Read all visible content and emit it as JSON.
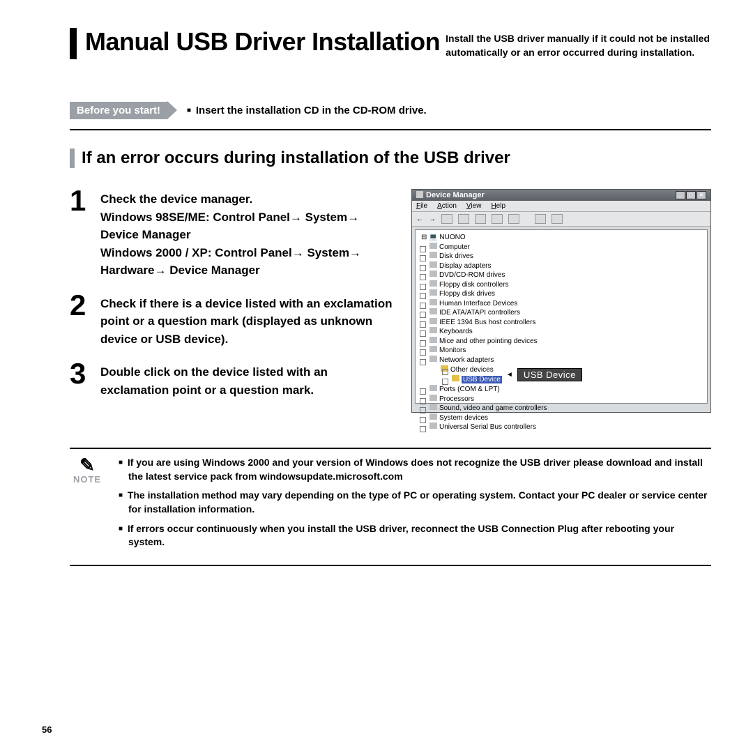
{
  "header": {
    "title": "Manual USB Driver Installation",
    "subtitle": "Install the USB driver manually if it could not be installed automatically or an error occurred during installation."
  },
  "before": {
    "badge": "Before you start!",
    "text": "Insert the installation CD in the CD-ROM drive."
  },
  "section_heading": "If an error occurs during installation of the USB driver",
  "steps": [
    {
      "n": "1",
      "text": "Check the device manager.\nWindows 98SE/ME: Control Panel→ System→ Device Manager\nWindows 2000 / XP: Control Panel→ System→ Hardware→ Device Manager"
    },
    {
      "n": "2",
      "text": "Check if there is a device listed with an exclamation point or a question mark (displayed as unknown device or USB device)."
    },
    {
      "n": "3",
      "text": "Double click on the device listed with an exclamation point or a question mark."
    }
  ],
  "devmgr": {
    "title": "Device Manager",
    "menu": [
      "File",
      "Action",
      "View",
      "Help"
    ],
    "root": "NUONO",
    "items": [
      "Computer",
      "Disk drives",
      "Display adapters",
      "DVD/CD-ROM drives",
      "Floppy disk controllers",
      "Floppy disk drives",
      "Human Interface Devices",
      "IDE ATA/ATAPI controllers",
      "IEEE 1394 Bus host controllers",
      "Keyboards",
      "Mice and other pointing devices",
      "Monitors",
      "Network adapters"
    ],
    "other_devices": "Other devices",
    "usb_sel": "USB Device",
    "usb_callout": "USB Device",
    "items_after": [
      "Ports (COM & LPT)",
      "Processors",
      "Sound, video and game controllers",
      "System devices",
      "Universal Serial Bus controllers"
    ]
  },
  "note": {
    "label": "NOTE",
    "items": [
      "If you are using Windows 2000 and your version of Windows does not recognize the USB driver please download and install the latest service pack from windowsupdate.microsoft.com",
      "The installation method may vary depending on the type of PC or operating system. Contact your PC dealer or service center for installation information.",
      "If errors occur continuously when you install the USB driver, reconnect the USB Connection Plug after rebooting your system."
    ]
  },
  "page_number": "56"
}
